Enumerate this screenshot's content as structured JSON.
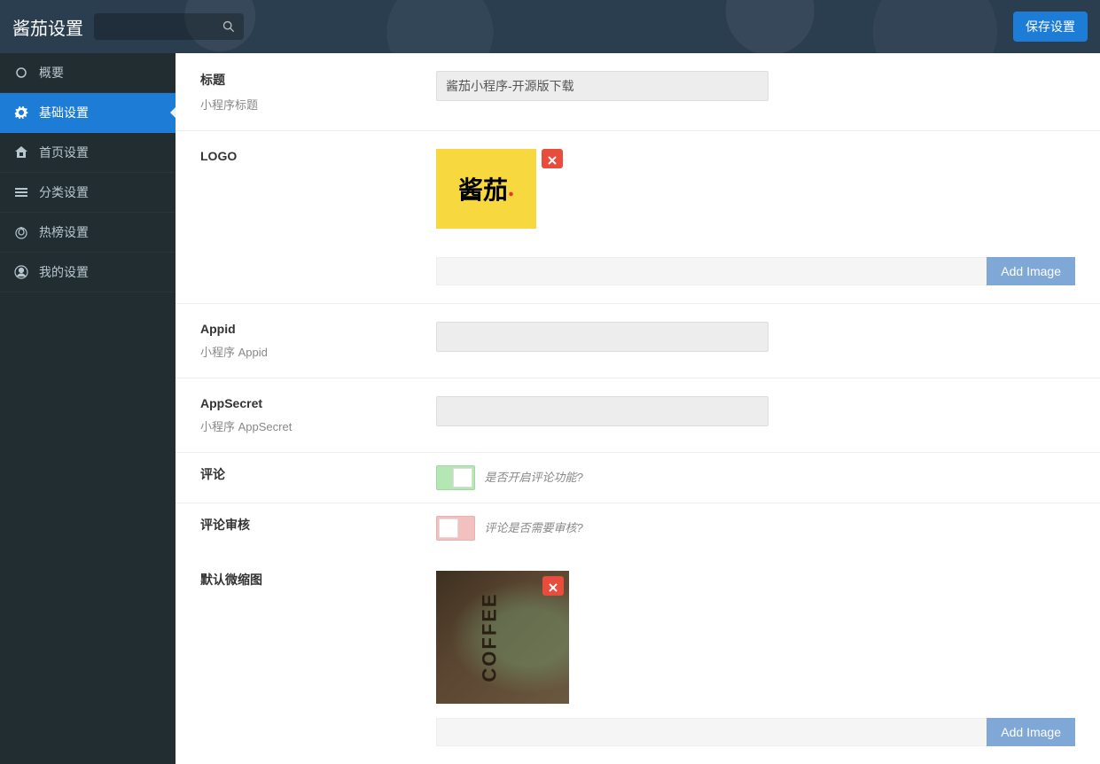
{
  "header": {
    "brand": "酱茄设置",
    "save_label": "保存设置"
  },
  "sidebar": {
    "items": [
      {
        "icon": "circle",
        "label": "概要"
      },
      {
        "icon": "gear",
        "label": "基础设置",
        "active": true
      },
      {
        "icon": "home",
        "label": "首页设置"
      },
      {
        "icon": "list",
        "label": "分类设置"
      },
      {
        "icon": "fire",
        "label": "热榜设置"
      },
      {
        "icon": "user",
        "label": "我的设置"
      }
    ]
  },
  "form": {
    "title": {
      "label": "标题",
      "desc": "小程序标题",
      "value": "酱茄小程序-开源版下载"
    },
    "logo": {
      "label": "LOGO",
      "logo_text": "酱茄",
      "add_image": "Add Image"
    },
    "appid": {
      "label": "Appid",
      "desc": "小程序 Appid",
      "value": ""
    },
    "appsecret": {
      "label": "AppSecret",
      "desc": "小程序 AppSecret",
      "value": ""
    },
    "comment": {
      "label": "评论",
      "desc": "是否开启评论功能?"
    },
    "comment_audit": {
      "label": "评论审核",
      "desc": "评论是否需要审核?"
    },
    "thumbnail": {
      "label": "默认微缩图",
      "coffee_text": "COFFEE",
      "add_image": "Add Image"
    }
  }
}
